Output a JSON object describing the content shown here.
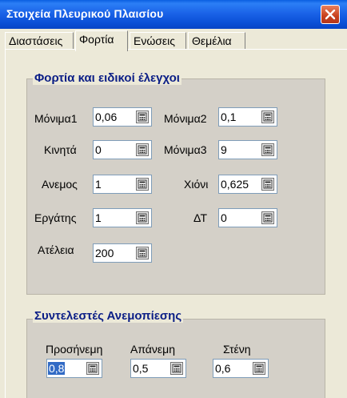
{
  "window": {
    "title": "Στοιχεία Πλευρικού Πλαισίου"
  },
  "tabs": [
    {
      "label": "Διαστάσεις"
    },
    {
      "label": "Φορτία"
    },
    {
      "label": "Ενώσεις"
    },
    {
      "label": "Θεμέλια"
    }
  ],
  "active_tab": "Φορτία",
  "loads_group": {
    "title": "Φορτία και ειδικοί έλεγχοι",
    "fields": [
      {
        "label": "Μόνιμα1",
        "value": "0,06"
      },
      {
        "label": "Μόνιμα2",
        "value": "0,1"
      },
      {
        "label": "Κινητά",
        "value": "0"
      },
      {
        "label": "Μόνιμα3",
        "value": "9"
      },
      {
        "label": "Ανεμος",
        "value": "1"
      },
      {
        "label": "Χιόνι",
        "value": "0,625"
      },
      {
        "label": "Εργάτης",
        "value": "1"
      },
      {
        "label": "ΔΤ",
        "value": "0"
      },
      {
        "label": "Ατέλεια",
        "value": "200"
      }
    ]
  },
  "wind_group": {
    "title": "Συντελεστές Ανεμοπίεσης",
    "fields": [
      {
        "label": "Προσήνεμη",
        "value": "0,8"
      },
      {
        "label": "Απάνεμη",
        "value": "0,5"
      },
      {
        "label": "Στένη",
        "value": "0,6"
      }
    ]
  },
  "icons": {
    "close": "close-icon",
    "calculator": "calculator-icon"
  },
  "colors": {
    "titlebar": "#0A4FD6",
    "group_title": "#0B1E86",
    "selection": "#316AC5"
  }
}
